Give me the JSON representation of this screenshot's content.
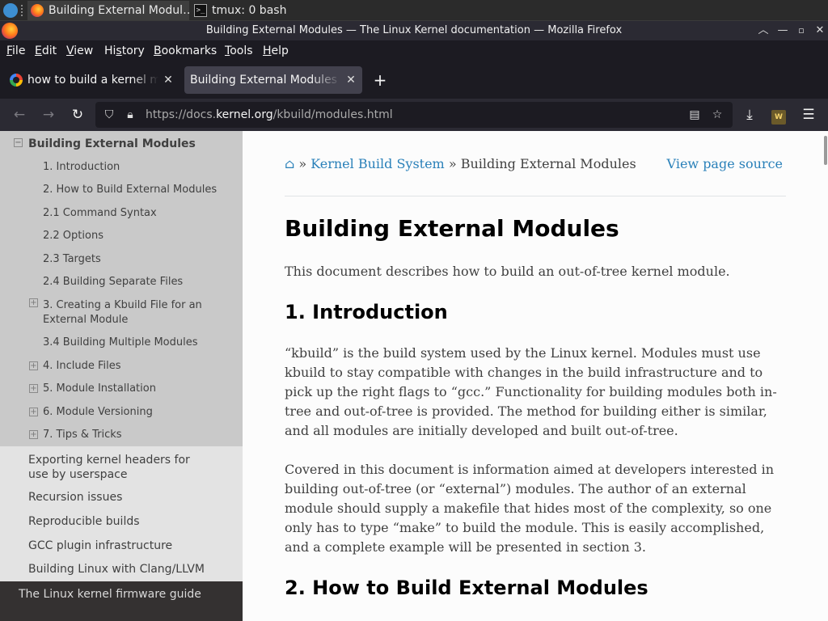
{
  "taskbar": {
    "tasks": [
      {
        "label": "Building External Modul…"
      },
      {
        "label": "tmux: 0 bash"
      }
    ]
  },
  "window": {
    "title": "Building External Modules — The Linux Kernel documentation — Mozilla Firefox"
  },
  "menu": {
    "items": [
      {
        "label": "File",
        "underline": "F",
        "rest": "ile"
      },
      {
        "label": "Edit",
        "underline": "E",
        "rest": "dit"
      },
      {
        "label": "View",
        "underline": "V",
        "rest": "iew"
      },
      {
        "label": "History",
        "pre": "Hi",
        "underline": "s",
        "rest": "tory"
      },
      {
        "label": "Bookmarks",
        "underline": "B",
        "rest": "ookmarks"
      },
      {
        "label": "Tools",
        "underline": "T",
        "rest": "ools"
      },
      {
        "label": "Help",
        "underline": "H",
        "rest": "elp"
      }
    ]
  },
  "tabs": [
    {
      "title": "how to build a kernel module",
      "close": "✕"
    },
    {
      "title": "Building External Modules — The Linux Kernel documentation",
      "close": "✕"
    }
  ],
  "newtab_label": "+",
  "nav": {
    "url_prefix": "https://docs.",
    "url_domain": "kernel.org",
    "url_path": "/kbuild/modules.html",
    "ext_badge": "W"
  },
  "sidebar": {
    "current": "Building External Modules",
    "subitems": [
      {
        "label": "1. Introduction"
      },
      {
        "label": "2. How to Build External Modules"
      },
      {
        "label": "2.1 Command Syntax"
      },
      {
        "label": "2.2 Options"
      },
      {
        "label": "2.3 Targets"
      },
      {
        "label": "2.4 Building Separate Files"
      },
      {
        "label": "3. Creating a Kbuild File for an",
        "label2": "External Module"
      },
      {
        "label": "3.4 Building Multiple Modules"
      },
      {
        "label": "4. Include Files"
      },
      {
        "label": "5. Module Installation"
      },
      {
        "label": "6. Module Versioning"
      },
      {
        "label": "7. Tips & Tricks"
      }
    ],
    "siblings": [
      {
        "label": "Exporting kernel headers for",
        "label2": "use by userspace"
      },
      {
        "label": "Recursion issues"
      },
      {
        "label": "Reproducible builds"
      },
      {
        "label": "GCC plugin infrastructure"
      },
      {
        "label": "Building Linux with Clang/LLVM"
      }
    ],
    "next_section": "The Linux kernel firmware guide",
    "toggle_minus": "−",
    "toggle_plus": "+"
  },
  "content": {
    "breadcrumb_parent": "Kernel Build System",
    "breadcrumb_current": "Building External Modules",
    "view_source": "View page source",
    "sep": "»",
    "title": "Building External Modules",
    "intro": "This document describes how to build an out-of-tree kernel module.",
    "h_intro": "1. Introduction",
    "para1": [
      "“kbuild” is the build system used by the Linux kernel. Modules must use",
      "kbuild to stay compatible with changes in the build infrastructure and to",
      "pick up the right flags to “gcc.” Functionality for building modules both in-",
      "tree and out-of-tree is provided. The method for building either is similar,",
      "and all modules are initially developed and built out-of-tree."
    ],
    "para2": [
      "Covered in this document is information aimed at developers interested in",
      "building out-of-tree (or “external”) modules. The author of an external",
      "module should supply a makefile that hides most of the complexity, so one",
      "only has to type “make” to build the module. This is easily accomplished,",
      "and a complete example will be presented in section 3."
    ],
    "h_build": "2. How to Build External Modules"
  }
}
